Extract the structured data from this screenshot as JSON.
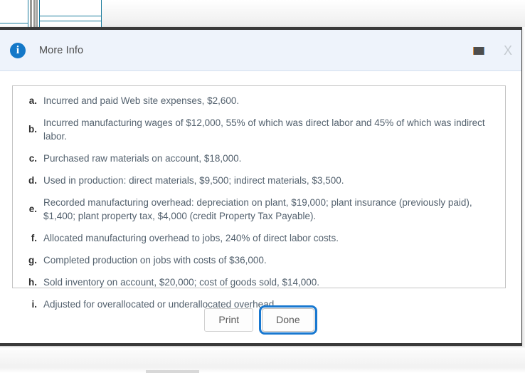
{
  "dialog": {
    "title": "More Info",
    "info_icon": "info-circle-icon",
    "minimize_icon": "minimize-icon",
    "close_icon": "close-icon",
    "close_glyph": "X",
    "info_glyph": "i",
    "accent_color": "#1478c8",
    "header_bg": "#eef3fb",
    "focus_ring_color": "#1878d0"
  },
  "content": {
    "items": [
      {
        "marker": "a.",
        "text": "Incurred and paid Web site expenses, $2,600."
      },
      {
        "marker": "b.",
        "text": "Incurred manufacturing wages of $12,000, 55% of which was direct labor and 45% of which was indirect labor."
      },
      {
        "marker": "c.",
        "text": "Purchased raw materials on account, $18,000."
      },
      {
        "marker": "d.",
        "text": "Used in production: direct materials, $9,500; indirect materials, $3,500."
      },
      {
        "marker": "e.",
        "text": "Recorded manufacturing overhead: depreciation on plant, $19,000; plant insurance (previously paid), $1,400; plant property tax, $4,000 (credit Property Tax Payable)."
      },
      {
        "marker": "f.",
        "text": "Allocated manufacturing overhead to jobs, 240% of direct labor costs."
      },
      {
        "marker": "g.",
        "text": "Completed production on jobs with costs of $36,000."
      },
      {
        "marker": "h.",
        "text": "Sold inventory on account, $20,000; cost of goods sold, $14,000."
      },
      {
        "marker": "i.",
        "text": "Adjusted for overallocated or underallocated overhead."
      }
    ]
  },
  "footer": {
    "print_label": "Print",
    "done_label": "Done"
  }
}
